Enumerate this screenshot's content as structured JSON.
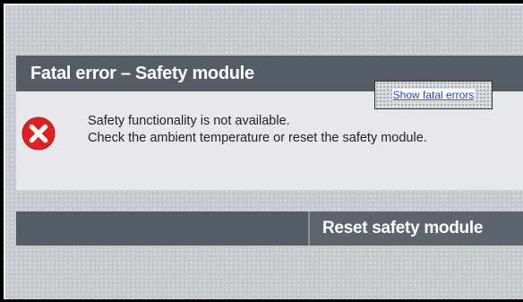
{
  "dialog": {
    "title": "Fatal error – Safety module",
    "message_line1": "Safety functionality is not available.",
    "message_line2": "Check the ambient temperature or reset the safety module.",
    "show_errors_link": "Show fatal errors",
    "reset_button_label": "Reset safety module",
    "icon": "error-x-icon"
  },
  "colors": {
    "header_bg": "#555c66",
    "body_bg": "#e6e8eb",
    "error_red": "#e02020",
    "link_blue": "#1f3fd6"
  }
}
